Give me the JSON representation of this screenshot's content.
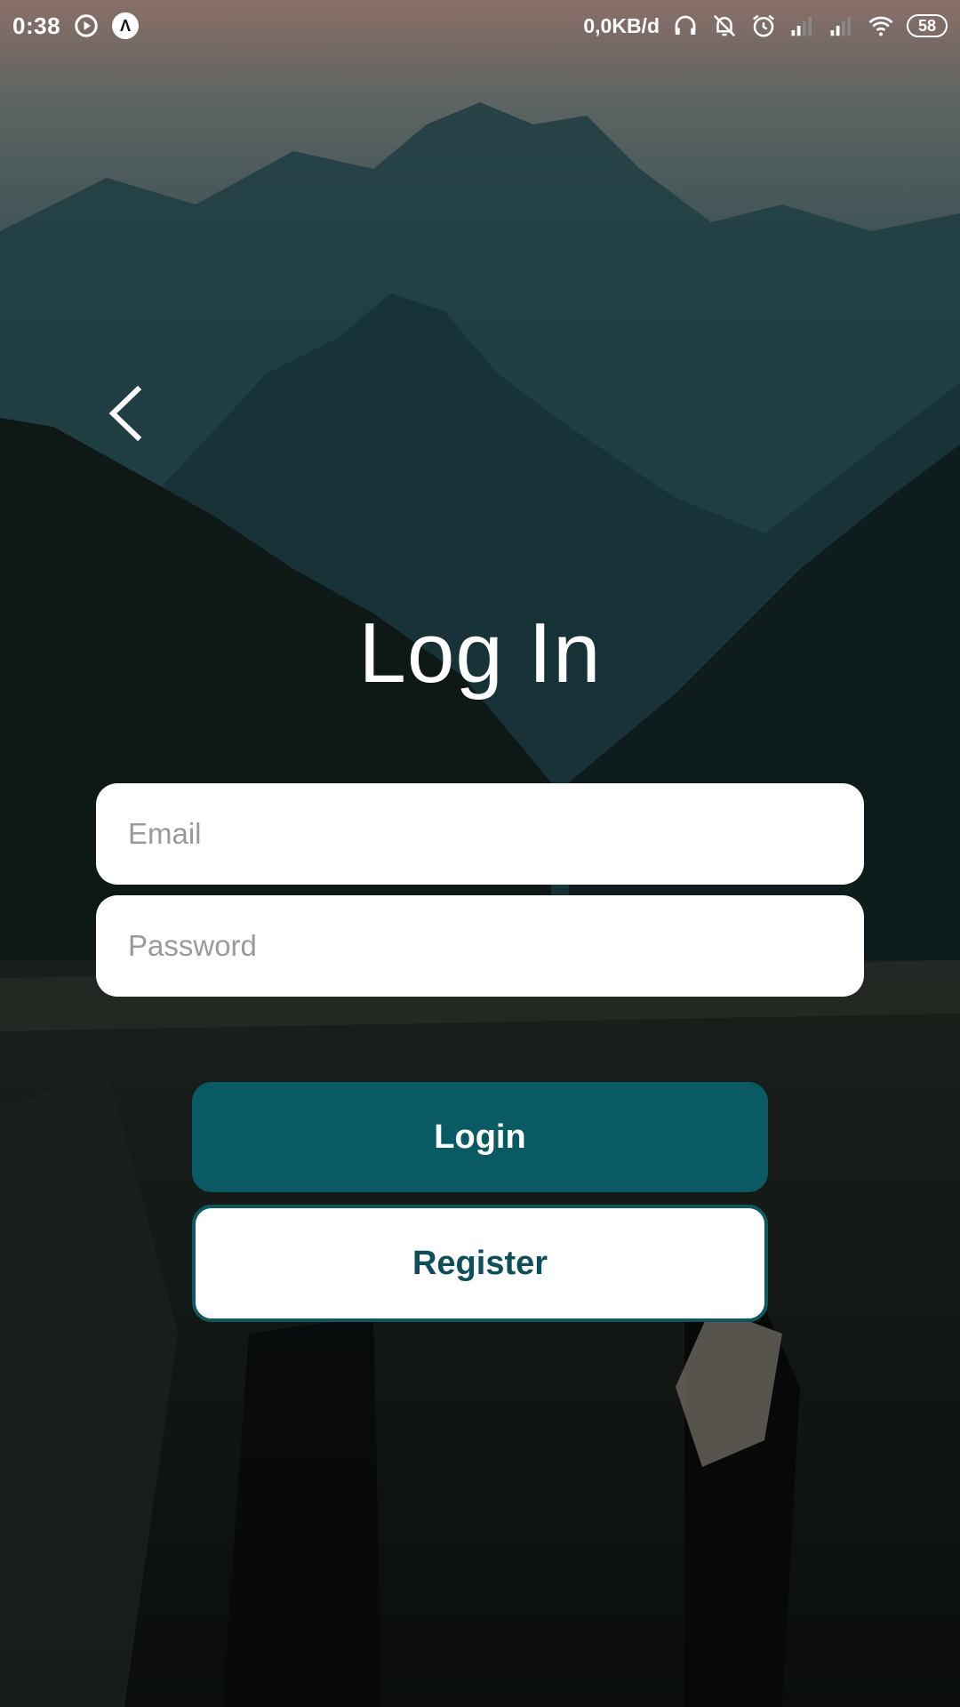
{
  "status_bar": {
    "time": "0:38",
    "app_icon_letter": "Λ",
    "network_speed": "0,0KB/d",
    "battery": "58",
    "icons": [
      "sync-icon",
      "app-icon",
      "headphones-icon",
      "bell-off-icon",
      "alarm-icon",
      "signal-icon",
      "signal-icon",
      "wifi-icon",
      "battery-icon"
    ]
  },
  "nav": {
    "back_icon": "chevron-left-icon"
  },
  "page": {
    "title": "Log In"
  },
  "form": {
    "email_placeholder": "Email",
    "email_value": "",
    "password_placeholder": "Password",
    "password_value": ""
  },
  "actions": {
    "login_label": "Login",
    "register_label": "Register"
  },
  "colors": {
    "primary": "#095a62",
    "register_text": "#0d4e57",
    "field_bg": "#ffffff",
    "placeholder": "#9a9a9a"
  }
}
